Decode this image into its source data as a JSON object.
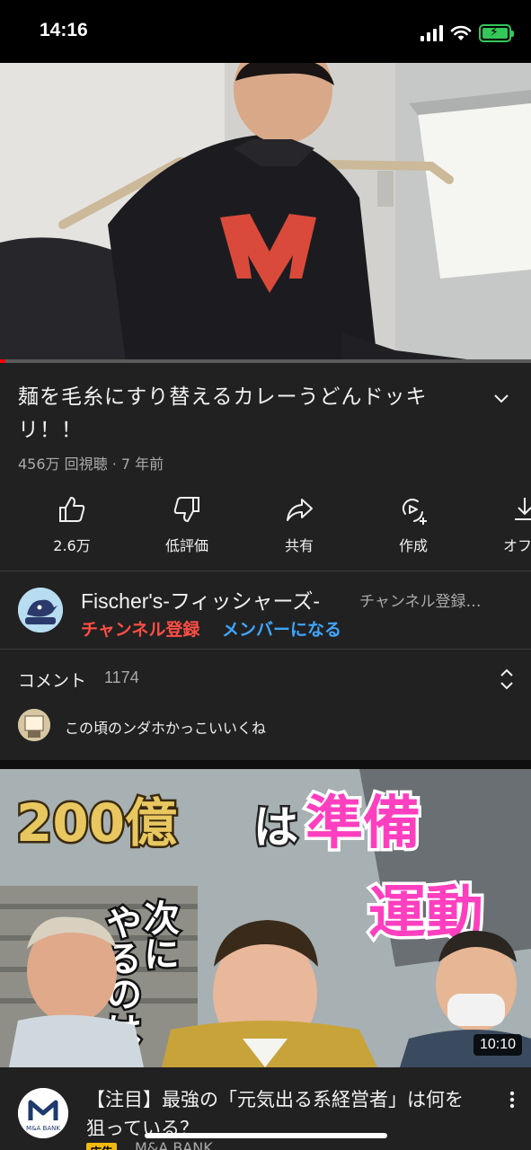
{
  "status_bar": {
    "time": "14:16",
    "battery_color": "#34c759"
  },
  "player": {
    "progress_fraction": 0.01,
    "progress_color": "#ff0000"
  },
  "video": {
    "title": "麺を毛糸にすり替えるカレーうどんドッキリ！！",
    "meta": "456万 回視聴 · 7 年前"
  },
  "actions": [
    {
      "label": "2.6万",
      "icon": "thumbs-up-icon"
    },
    {
      "label": "低評価",
      "icon": "thumbs-down-icon"
    },
    {
      "label": "共有",
      "icon": "share-icon"
    },
    {
      "label": "作成",
      "icon": "remix-icon"
    },
    {
      "label": "オフラ",
      "icon": "download-icon"
    }
  ],
  "channel": {
    "name": "Fischer's-フィッシャーズ-",
    "subscribers": "チャンネル登録…",
    "subscribe_label": "チャンネル登録",
    "member_label": "メンバーになる",
    "subscribe_color": "#ff4e45",
    "member_color": "#3ea6ff"
  },
  "comments": {
    "label": "コメント",
    "count": "1174",
    "top_comment": "この頃のンダホかっこいいくね"
  },
  "recommended": {
    "thumbnail_text": [
      "200億",
      "は",
      "準備",
      "運動",
      "次に",
      "やるのは…"
    ],
    "duration": "10:10",
    "title": "【注目】最強の「元気出る系経営者」は何を狙っている？",
    "ad_badge": "広告",
    "channel": "M&A BANK",
    "avatar_text": "M&A BANK"
  }
}
